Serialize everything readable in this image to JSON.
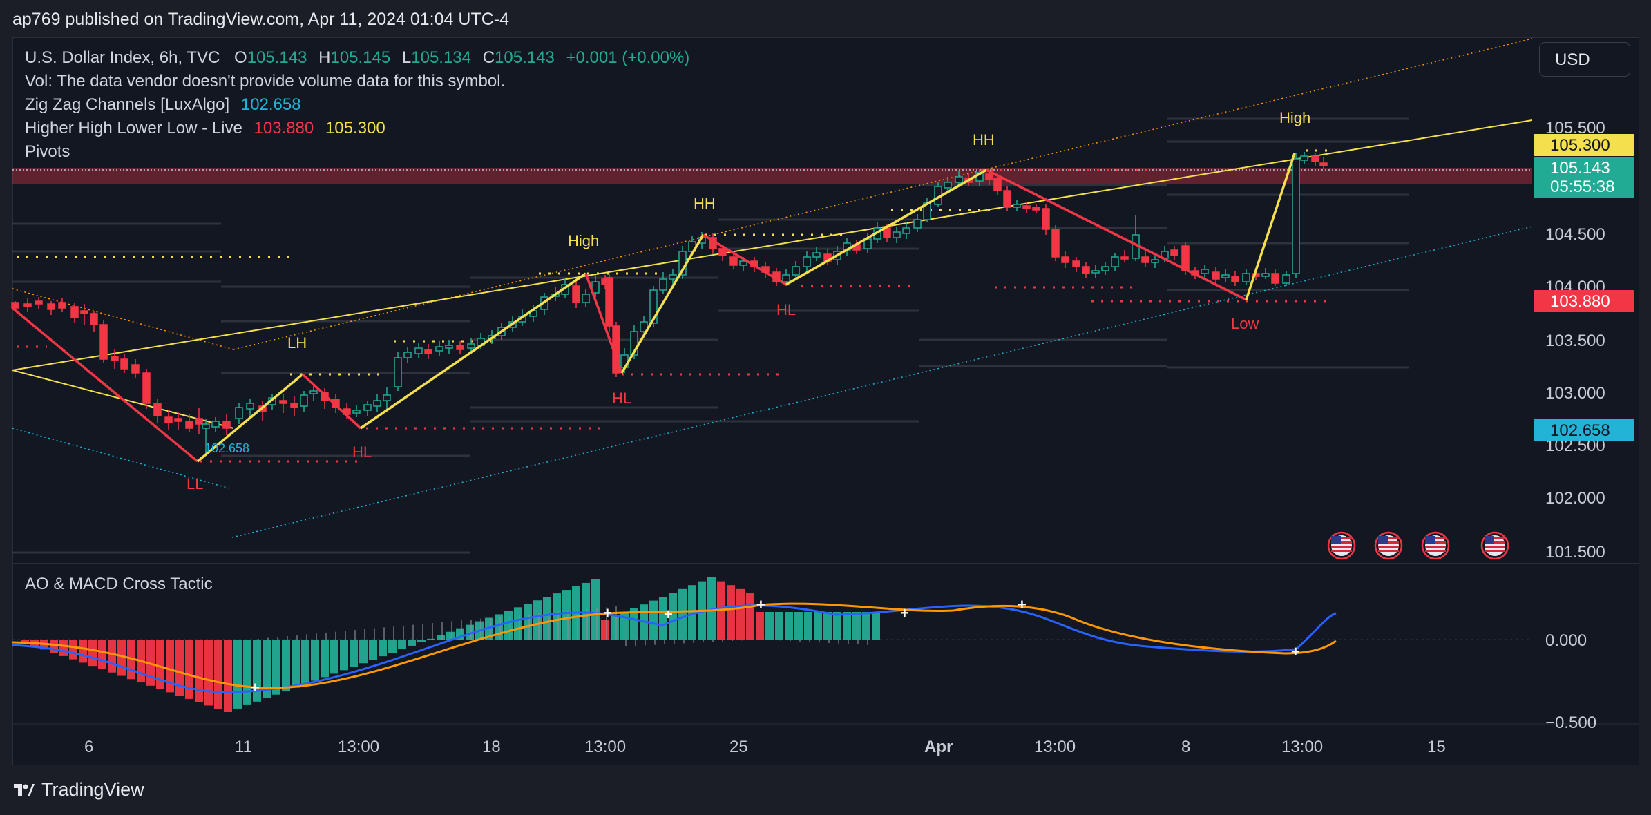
{
  "header": {
    "published_by": "ap769 published on TradingView.com, Apr 11, 2024 01:04 UTC-4"
  },
  "legend": {
    "symbol": "U.S. Dollar Index, 6h, TVC",
    "ohlc": {
      "o_label": "O",
      "o": "105.143",
      "h_label": "H",
      "h": "105.145",
      "l_label": "L",
      "l": "105.134",
      "c_label": "C",
      "c": "105.143",
      "change": "+0.001 (+0.00%)"
    },
    "vol_note": "Vol: The data vendor doesn't provide volume data for this symbol.",
    "zigzag_label": "Zig Zag Channels [LuxAlgo]",
    "zigzag_value": "102.658",
    "hhll_label": "Higher High Lower Low - Live",
    "hhll_value1": "103.880",
    "hhll_value2": "105.300",
    "pivots_label": "Pivots"
  },
  "currency_selector": "USD",
  "price_badges": {
    "hh_level": {
      "text": "105.300",
      "bg": "#f4e04d",
      "fg": "#131722"
    },
    "last_price": {
      "text": "105.143",
      "countdown": "05:55:38",
      "bg": "#22ab94",
      "fg": "#ffffff"
    },
    "ll_level": {
      "text": "103.880",
      "bg": "#f23645",
      "fg": "#ffffff"
    },
    "zigzag": {
      "text": "102.658",
      "bg": "#22b3d6",
      "fg": "#131722"
    }
  },
  "price_axis": [
    "105.500",
    "104.500",
    "104.000",
    "103.500",
    "103.000",
    "102.500",
    "102.000",
    "101.500"
  ],
  "osc_axis": [
    "0.000",
    "−0.500"
  ],
  "time_axis": [
    "6",
    "11",
    "13:00",
    "18",
    "13:00",
    "25",
    "Apr",
    "13:00",
    "8",
    "13:00",
    "15"
  ],
  "pivot_labels": [
    "LL",
    "LH",
    "HL",
    "High",
    "HL",
    "HH",
    "HL",
    "HH",
    "Low",
    "High"
  ],
  "zigzag_point_label": "102.658",
  "oscillator_title": "AO & MACD Cross Tactic",
  "footer_brand": "TradingView",
  "colors": {
    "bg": "#131722",
    "up": "#22ab94",
    "down": "#f23645",
    "zigzag": "#f4e04d",
    "channel": "#22b3d6",
    "macd": "#2962ff",
    "signal": "#ff9800"
  },
  "chart_data": [
    {
      "type": "candlestick",
      "title": "U.S. Dollar Index, 6h, TVC",
      "ylim": [
        101.45,
        105.85
      ],
      "x": [
        "6",
        "11",
        "13:00",
        "18",
        "13:00",
        "25",
        "Apr",
        "13:00",
        "8",
        "13:00",
        "15"
      ],
      "pivots": [
        {
          "label": "LL",
          "price": 102.36
        },
        {
          "label": "LH",
          "price": 103.17
        },
        {
          "label": "HL",
          "price": 102.69
        },
        {
          "label": "High",
          "price": 104.16
        },
        {
          "label": "HL",
          "price": 103.17
        },
        {
          "label": "HH",
          "price": 104.49
        },
        {
          "label": "HL",
          "price": 104.02
        },
        {
          "label": "HH",
          "price": 105.11
        },
        {
          "label": "Low",
          "price": 103.88
        },
        {
          "label": "High",
          "price": 105.3
        }
      ],
      "last": {
        "open": 105.143,
        "high": 105.145,
        "low": 105.134,
        "close": 105.143
      }
    },
    {
      "type": "bar",
      "title": "AO & MACD Cross Tactic",
      "ylim": [
        -0.55,
        0.35
      ],
      "series": [
        {
          "name": "AO"
        },
        {
          "name": "MACD"
        },
        {
          "name": "Signal"
        }
      ]
    }
  ]
}
